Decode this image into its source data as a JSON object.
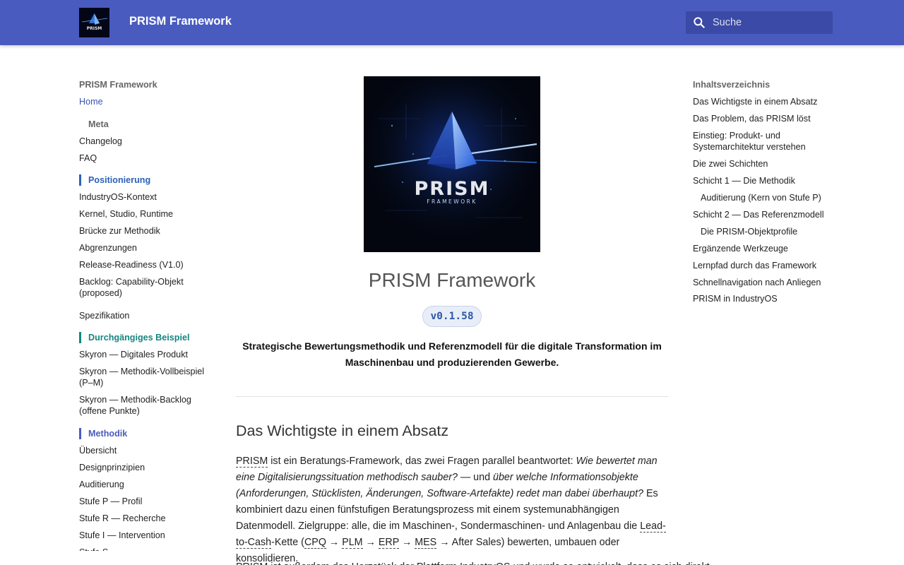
{
  "header": {
    "logo_text": "PRISM",
    "site_title": "PRISM Framework",
    "search_placeholder": "Suche"
  },
  "nav": {
    "title": "PRISM Framework",
    "home": "Home",
    "meta": "Meta",
    "changelog": "Changelog",
    "faq": "FAQ",
    "positionierung": "Positionierung",
    "pos_items": [
      "IndustryOS-Kontext",
      "Kernel, Studio, Runtime",
      "Brücke zur Methodik",
      "Abgrenzungen",
      "Release-Readiness (V1.0)",
      "Backlog: Capability-Objekt (proposed)"
    ],
    "spezifikation": "Spezifikation",
    "beispiel": "Durchgängiges Beispiel",
    "beispiel_items": [
      "Skyron — Digitales Produkt",
      "Skyron — Methodik-Vollbeispiel (P–M)",
      "Skyron — Methodik-Backlog (offene Punkte)"
    ],
    "methodik": "Methodik",
    "methodik_items": [
      "Übersicht",
      "Designprinzipien",
      "Auditierung",
      "Stufe P — Profil",
      "Stufe R — Recherche",
      "Stufe I — Intervention",
      "Stufe S"
    ]
  },
  "toc": {
    "title": "Inhaltsverzeichnis",
    "items": [
      "Das Wichtigste in einem Absatz",
      "Das Problem, das PRISM löst",
      "Einstieg: Produkt- und Systemarchitektur verstehen",
      "Die zwei Schichten",
      "Schicht 1 — Die Methodik",
      "Auditierung (Kern von Stufe P)",
      "Schicht 2 — Das Referenzmodell",
      "Die PRISM-Objektprofile",
      "Ergänzende Werkzeuge",
      "Lernpfad durch das Framework",
      "Schnellnavigation nach Anliegen",
      "PRISM in IndustryOS"
    ]
  },
  "main": {
    "logo_word": "PRISM",
    "logo_sub": "FRAMEWORK",
    "title": "PRISM Framework",
    "version": "v0.1.58",
    "lead": "Strategische Bewertungsmethodik und Referenzmodell für die digitale Transformation im Maschinenbau und produzierenden Gewerbe.",
    "section_heading": "Das Wichtigste in einem Absatz",
    "p1": {
      "prism": "PRISM",
      "t1": " ist ein Beratungs-Framework, das zwei Fragen parallel beantwortet: ",
      "i1": "Wie bewertet man eine Digitalisierungssituation methodisch sauber?",
      "t2": " — und ",
      "i2": "über welche Informationsobjekte (Anforderungen, Stücklisten, Änderungen, Software-Artefakte) redet man dabei überhaupt?",
      "t3": " Es kombiniert dazu einen fünfstufigen Beratungsprozess mit einem systemunabhängigen Datenmodell. Zielgruppe: alle, die im Maschinen-, Sondermaschinen- und Anlagenbau die ",
      "l2c": "Lead-to-Cash",
      "t4": "-Kette (",
      "cpq": "CPQ",
      "arrow": " → ",
      "plm": "PLM",
      "erp": "ERP",
      "mes": "MES",
      "t5": " → After Sales) bewerten, umbauen oder konsolidieren."
    },
    "p2": "PRISM ist außerdem das Herzstück der Plattform IndustryOS und wurde so entwickelt, dass es sich direkt"
  },
  "colors": {
    "header_bg": "#4a5bbf",
    "accent_blue": "#2a62b9",
    "accent_teal": "#14867f",
    "accent_indigo": "#4a5bbf"
  }
}
